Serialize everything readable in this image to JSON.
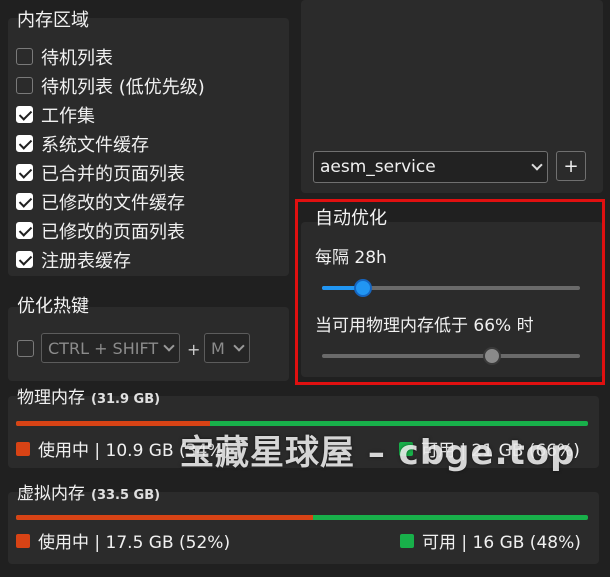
{
  "memory_area": {
    "title": "内存区域",
    "items": [
      {
        "label": "待机列表",
        "checked": false
      },
      {
        "label": "待机列表 (低优先级)",
        "checked": false
      },
      {
        "label": "工作集",
        "checked": true
      },
      {
        "label": "系统文件缓存",
        "checked": true
      },
      {
        "label": "已合并的页面列表",
        "checked": true
      },
      {
        "label": "已修改的文件缓存",
        "checked": true
      },
      {
        "label": "已修改的页面列表",
        "checked": true
      },
      {
        "label": "注册表缓存",
        "checked": true
      }
    ]
  },
  "hotkey": {
    "title": "优化热键",
    "enabled": false,
    "modifier": "CTRL + SHIFT",
    "plus": "+",
    "key": "M"
  },
  "process": {
    "selected": "aesm_service",
    "add_label": "+"
  },
  "auto_optimize": {
    "title": "自动优化",
    "interval_label": "每隔 28h",
    "interval_level": 0.16,
    "threshold_label": "当可用物理内存低于 66% 时",
    "threshold_level": 0.66
  },
  "physical_memory": {
    "title": "物理内存",
    "total": "(31.9 GB)",
    "used_label": "使用中 | 10.9 GB (34%)",
    "used_fraction": 0.34,
    "free_label": "可用 | 21 GB (66%)"
  },
  "virtual_memory": {
    "title": "虚拟内存",
    "total": "(33.5 GB)",
    "used_label": "使用中 | 17.5 GB (52%)",
    "used_fraction": 0.52,
    "free_label": "可用 | 16 GB (48%)"
  },
  "colors": {
    "used": "#d84315",
    "free": "#18b04a",
    "accent": "#2196f3",
    "highlight": "#e01010"
  },
  "watermark": "宝藏星球屋 – cbge.top"
}
